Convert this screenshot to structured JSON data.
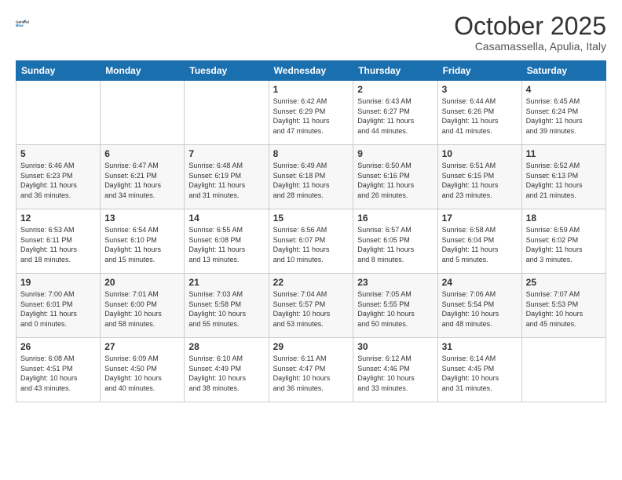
{
  "logo": {
    "line1": "General",
    "line2": "Blue"
  },
  "header": {
    "month": "October 2025",
    "location": "Casamassella, Apulia, Italy"
  },
  "weekdays": [
    "Sunday",
    "Monday",
    "Tuesday",
    "Wednesday",
    "Thursday",
    "Friday",
    "Saturday"
  ],
  "weeks": [
    [
      {
        "day": "",
        "info": ""
      },
      {
        "day": "",
        "info": ""
      },
      {
        "day": "",
        "info": ""
      },
      {
        "day": "1",
        "info": "Sunrise: 6:42 AM\nSunset: 6:29 PM\nDaylight: 11 hours\nand 47 minutes."
      },
      {
        "day": "2",
        "info": "Sunrise: 6:43 AM\nSunset: 6:27 PM\nDaylight: 11 hours\nand 44 minutes."
      },
      {
        "day": "3",
        "info": "Sunrise: 6:44 AM\nSunset: 6:26 PM\nDaylight: 11 hours\nand 41 minutes."
      },
      {
        "day": "4",
        "info": "Sunrise: 6:45 AM\nSunset: 6:24 PM\nDaylight: 11 hours\nand 39 minutes."
      }
    ],
    [
      {
        "day": "5",
        "info": "Sunrise: 6:46 AM\nSunset: 6:23 PM\nDaylight: 11 hours\nand 36 minutes."
      },
      {
        "day": "6",
        "info": "Sunrise: 6:47 AM\nSunset: 6:21 PM\nDaylight: 11 hours\nand 34 minutes."
      },
      {
        "day": "7",
        "info": "Sunrise: 6:48 AM\nSunset: 6:19 PM\nDaylight: 11 hours\nand 31 minutes."
      },
      {
        "day": "8",
        "info": "Sunrise: 6:49 AM\nSunset: 6:18 PM\nDaylight: 11 hours\nand 28 minutes."
      },
      {
        "day": "9",
        "info": "Sunrise: 6:50 AM\nSunset: 6:16 PM\nDaylight: 11 hours\nand 26 minutes."
      },
      {
        "day": "10",
        "info": "Sunrise: 6:51 AM\nSunset: 6:15 PM\nDaylight: 11 hours\nand 23 minutes."
      },
      {
        "day": "11",
        "info": "Sunrise: 6:52 AM\nSunset: 6:13 PM\nDaylight: 11 hours\nand 21 minutes."
      }
    ],
    [
      {
        "day": "12",
        "info": "Sunrise: 6:53 AM\nSunset: 6:11 PM\nDaylight: 11 hours\nand 18 minutes."
      },
      {
        "day": "13",
        "info": "Sunrise: 6:54 AM\nSunset: 6:10 PM\nDaylight: 11 hours\nand 15 minutes."
      },
      {
        "day": "14",
        "info": "Sunrise: 6:55 AM\nSunset: 6:08 PM\nDaylight: 11 hours\nand 13 minutes."
      },
      {
        "day": "15",
        "info": "Sunrise: 6:56 AM\nSunset: 6:07 PM\nDaylight: 11 hours\nand 10 minutes."
      },
      {
        "day": "16",
        "info": "Sunrise: 6:57 AM\nSunset: 6:05 PM\nDaylight: 11 hours\nand 8 minutes."
      },
      {
        "day": "17",
        "info": "Sunrise: 6:58 AM\nSunset: 6:04 PM\nDaylight: 11 hours\nand 5 minutes."
      },
      {
        "day": "18",
        "info": "Sunrise: 6:59 AM\nSunset: 6:02 PM\nDaylight: 11 hours\nand 3 minutes."
      }
    ],
    [
      {
        "day": "19",
        "info": "Sunrise: 7:00 AM\nSunset: 6:01 PM\nDaylight: 11 hours\nand 0 minutes."
      },
      {
        "day": "20",
        "info": "Sunrise: 7:01 AM\nSunset: 6:00 PM\nDaylight: 10 hours\nand 58 minutes."
      },
      {
        "day": "21",
        "info": "Sunrise: 7:03 AM\nSunset: 5:58 PM\nDaylight: 10 hours\nand 55 minutes."
      },
      {
        "day": "22",
        "info": "Sunrise: 7:04 AM\nSunset: 5:57 PM\nDaylight: 10 hours\nand 53 minutes."
      },
      {
        "day": "23",
        "info": "Sunrise: 7:05 AM\nSunset: 5:55 PM\nDaylight: 10 hours\nand 50 minutes."
      },
      {
        "day": "24",
        "info": "Sunrise: 7:06 AM\nSunset: 5:54 PM\nDaylight: 10 hours\nand 48 minutes."
      },
      {
        "day": "25",
        "info": "Sunrise: 7:07 AM\nSunset: 5:53 PM\nDaylight: 10 hours\nand 45 minutes."
      }
    ],
    [
      {
        "day": "26",
        "info": "Sunrise: 6:08 AM\nSunset: 4:51 PM\nDaylight: 10 hours\nand 43 minutes."
      },
      {
        "day": "27",
        "info": "Sunrise: 6:09 AM\nSunset: 4:50 PM\nDaylight: 10 hours\nand 40 minutes."
      },
      {
        "day": "28",
        "info": "Sunrise: 6:10 AM\nSunset: 4:49 PM\nDaylight: 10 hours\nand 38 minutes."
      },
      {
        "day": "29",
        "info": "Sunrise: 6:11 AM\nSunset: 4:47 PM\nDaylight: 10 hours\nand 36 minutes."
      },
      {
        "day": "30",
        "info": "Sunrise: 6:12 AM\nSunset: 4:46 PM\nDaylight: 10 hours\nand 33 minutes."
      },
      {
        "day": "31",
        "info": "Sunrise: 6:14 AM\nSunset: 4:45 PM\nDaylight: 10 hours\nand 31 minutes."
      },
      {
        "day": "",
        "info": ""
      }
    ]
  ]
}
